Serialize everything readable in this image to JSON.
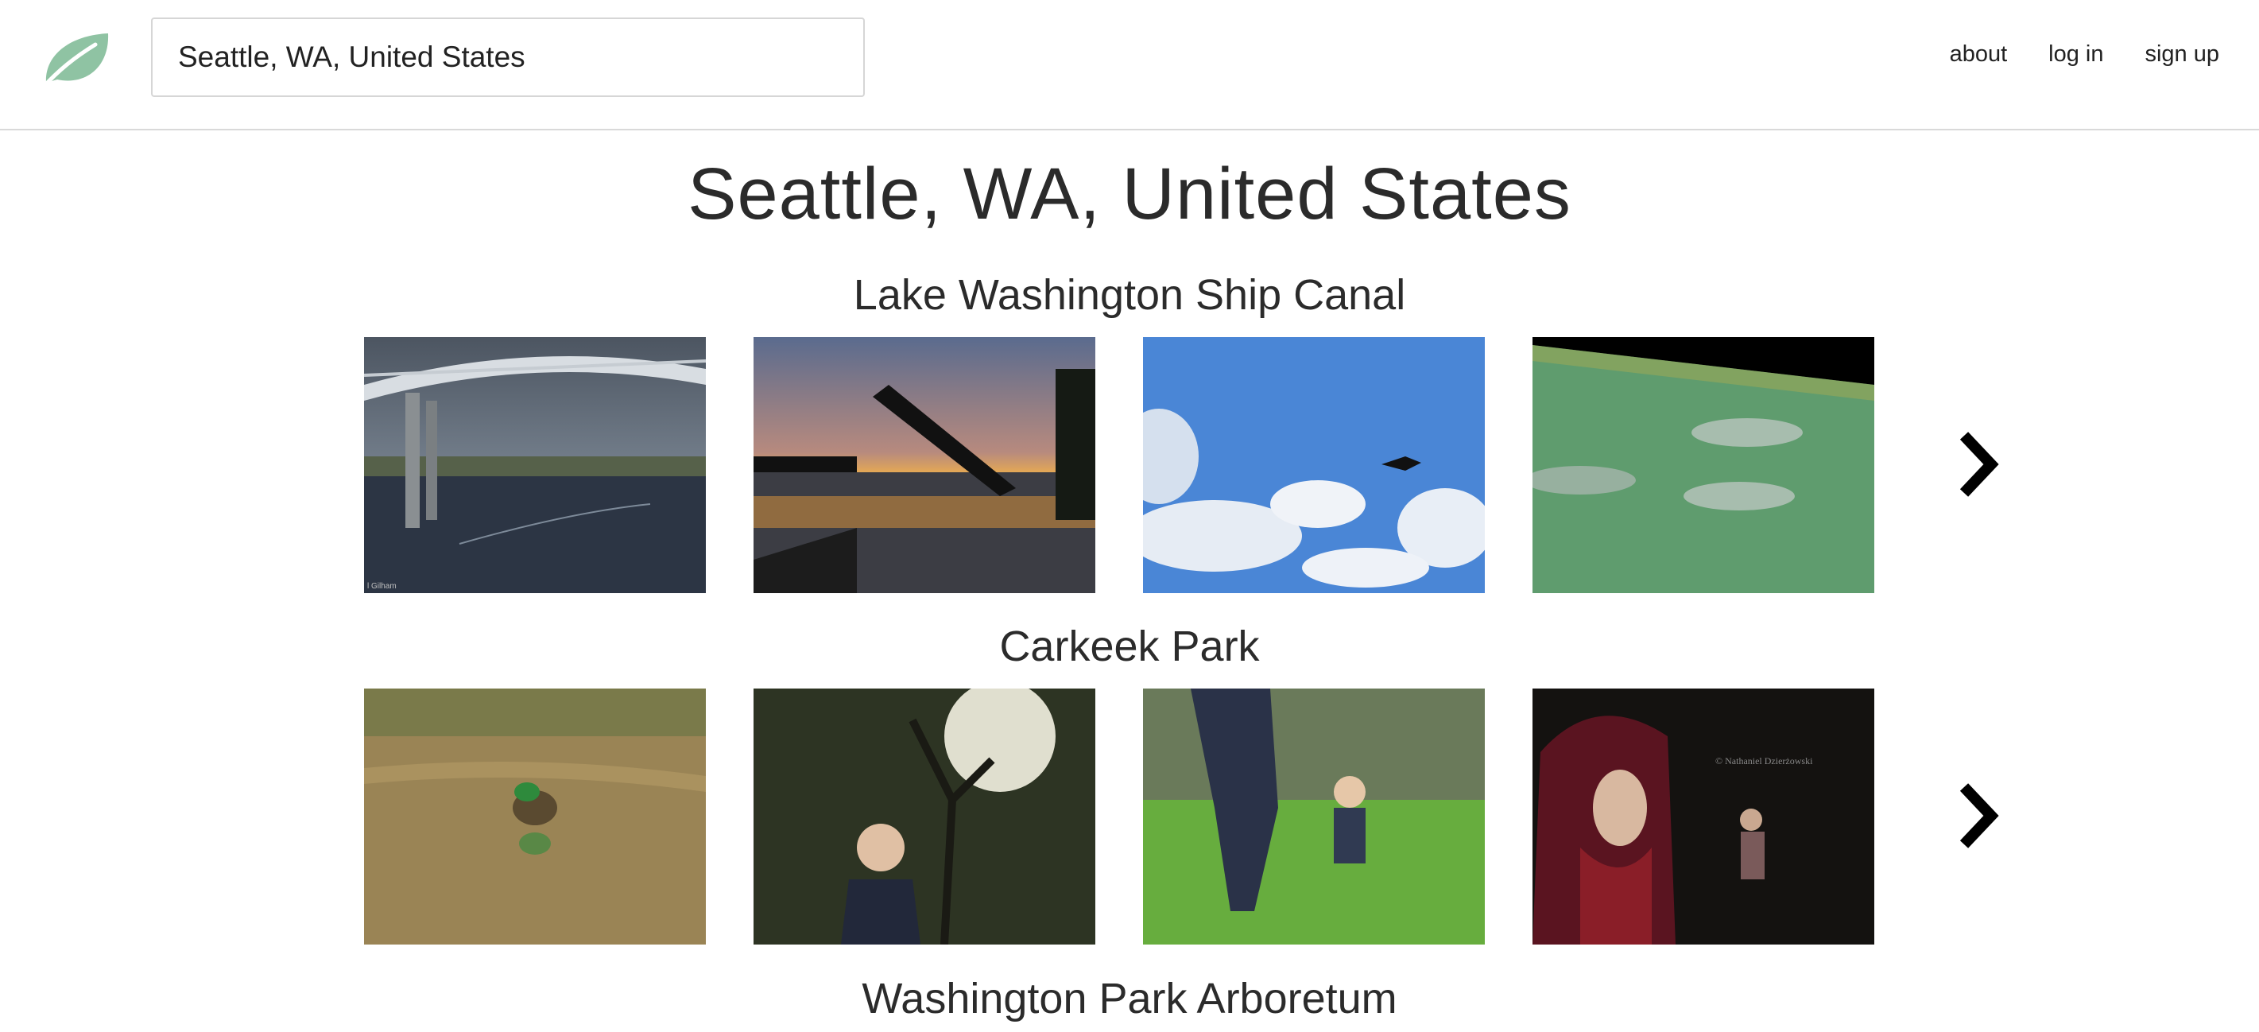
{
  "header": {
    "search_value": "Seattle, WA, United States",
    "nav": [
      "about",
      "log in",
      "sign up"
    ],
    "logo_icon": "leaf-icon",
    "accent_color": "#8fc3a3"
  },
  "page_title": "Seattle, WA, United States",
  "sections": [
    {
      "title": "Lake Washington Ship Canal",
      "photos": [
        {
          "caption": "",
          "watermark": "l Gilham"
        },
        {
          "caption": ""
        },
        {
          "caption": ""
        },
        {
          "caption": ""
        }
      ],
      "next_icon": "chevron-right-icon"
    },
    {
      "title": "Carkeek Park",
      "photos": [
        {
          "caption": ""
        },
        {
          "caption": ""
        },
        {
          "caption": ""
        },
        {
          "caption": "",
          "watermark": "© Nathaniel Dzierżowski"
        }
      ],
      "next_icon": "chevron-right-icon"
    },
    {
      "title": "Washington Park Arboretum"
    }
  ]
}
